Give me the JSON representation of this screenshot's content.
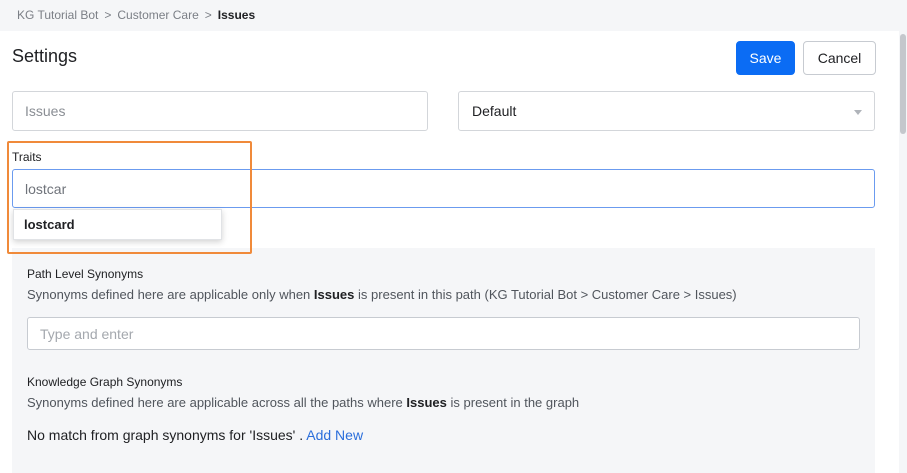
{
  "breadcrumb": {
    "items": [
      "KG Tutorial Bot",
      "Customer Care"
    ],
    "separator": ">",
    "current": "Issues"
  },
  "settings": {
    "title": "Settings",
    "save_label": "Save",
    "cancel_label": "Cancel",
    "name_placeholder": "Issues",
    "select_value": "Default"
  },
  "traits": {
    "label": "Traits",
    "input_value": "lostcar",
    "suggestion": "lostcard"
  },
  "path_synonyms": {
    "title": "Path Level Synonyms",
    "desc_prefix": "Synonyms defined here are applicable only when",
    "desc_bold": "Issues",
    "desc_suffix": "is present in this path (KG Tutorial Bot > Customer Care > Issues)",
    "input_placeholder": "Type and enter"
  },
  "graph_synonyms": {
    "title": "Knowledge Graph Synonyms",
    "desc_prefix": "Synonyms defined here are applicable across all the paths where",
    "desc_bold": "Issues",
    "desc_suffix": "is present in the graph",
    "no_match": "No match from graph synonyms for 'Issues' .",
    "add_new": "Add New"
  },
  "colors": {
    "primary": "#0b6cf4",
    "highlight": "#f08a3a",
    "link": "#2a6edb"
  }
}
